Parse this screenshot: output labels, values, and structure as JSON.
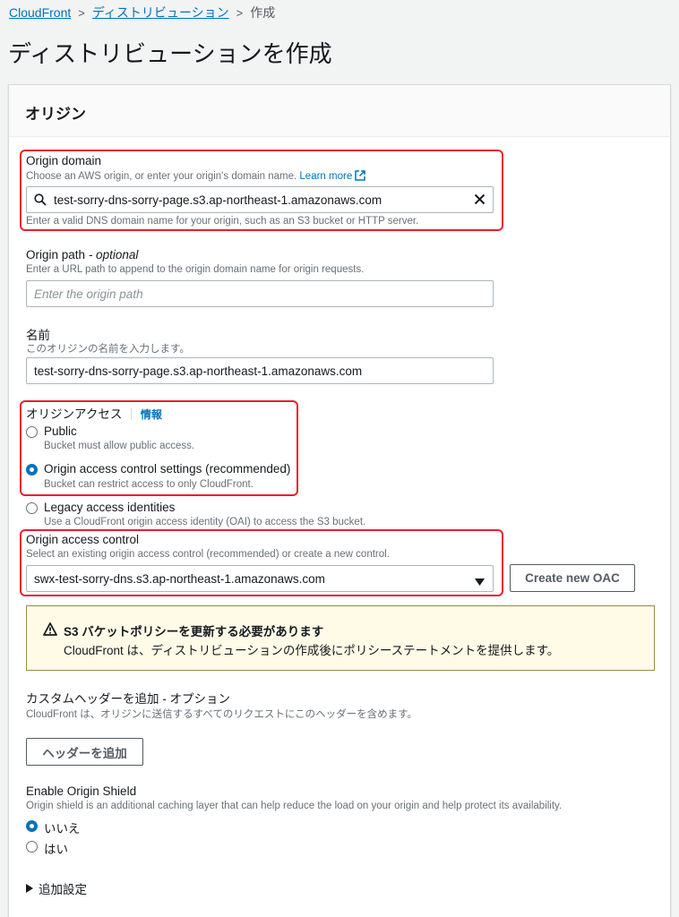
{
  "breadcrumb": {
    "items": [
      "CloudFront",
      "ディストリビューション"
    ],
    "current": "作成"
  },
  "page_title": "ディストリビューションを作成",
  "panel_title": "オリジン",
  "origin_domain": {
    "label": "Origin domain",
    "description": "Choose an AWS origin, or enter your origin's domain name.",
    "learn_more": "Learn more",
    "value": "test-sorry-dns-sorry-page.s3.ap-northeast-1.amazonaws.com",
    "hint": "Enter a valid DNS domain name for your origin, such as an S3 bucket or HTTP server."
  },
  "origin_path": {
    "label": "Origin path",
    "optional": "- optional",
    "description": "Enter a URL path to append to the origin domain name for origin requests.",
    "placeholder": "Enter the origin path"
  },
  "name": {
    "label": "名前",
    "description": "このオリジンの名前を入力します。",
    "value": "test-sorry-dns-sorry-page.s3.ap-northeast-1.amazonaws.com"
  },
  "origin_access": {
    "label": "オリジンアクセス",
    "info": "情報",
    "options": [
      {
        "label": "Public",
        "description": "Bucket must allow public access.",
        "checked": false
      },
      {
        "label": "Origin access control settings (recommended)",
        "description": "Bucket can restrict access to only CloudFront.",
        "checked": true
      },
      {
        "label": "Legacy access identities",
        "description": "Use a CloudFront origin access identity (OAI) to access the S3 bucket.",
        "checked": false
      }
    ]
  },
  "origin_access_control": {
    "label": "Origin access control",
    "description": "Select an existing origin access control (recommended) or create a new control.",
    "value": "swx-test-sorry-dns.s3.ap-northeast-1.amazonaws.com",
    "create_button": "Create new OAC"
  },
  "warning": {
    "title": "S3 バケットポリシーを更新する必要があります",
    "message": "CloudFront は、ディストリビューションの作成後にポリシーステートメントを提供します。"
  },
  "custom_headers": {
    "label": "カスタムヘッダーを追加 - オプション",
    "description": "CloudFront は、オリジンに送信するすべてのリクエストにこのヘッダーを含めます。",
    "button": "ヘッダーを追加"
  },
  "origin_shield": {
    "label": "Enable Origin Shield",
    "description": "Origin shield is an additional caching layer that can help reduce the load on your origin and help protect its availability.",
    "options": [
      {
        "label": "いいえ",
        "checked": true
      },
      {
        "label": "はい",
        "checked": false
      }
    ]
  },
  "additional_settings": "追加設定",
  "colors": {
    "link": "#0073bb",
    "highlight_red": "#e8202a",
    "warning_bg": "#fffbe7"
  }
}
